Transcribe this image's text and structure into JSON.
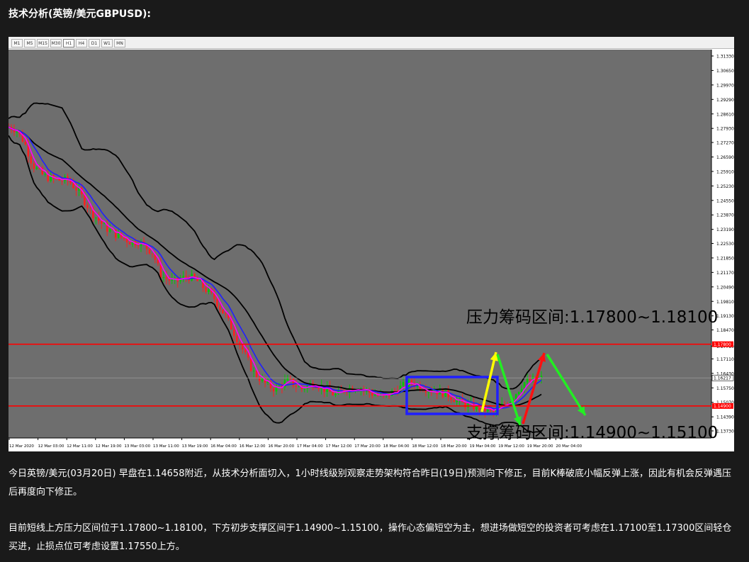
{
  "page": {
    "heading": "技术分析(英镑/美元GBPUSD):",
    "paragraphs": [
      "今日英镑/美元(03月20日) 早盘在1.14658附近，从技术分析面切入，1小时线级别观察走势架构符合昨日(19日)预测向下修正，目前K棒破底小幅反弹上涨，因此有机会反弹遇压后再度向下修正。",
      "目前短线上方压力区间位于1.17800~1.18100，下方初步支撑区间于1.14900~1.15100，操作心态偏短空为主，想进场做短空的投资者可考虑在1.17100至1.17300区间轻仓买进，止损点位可考虑设置1.17550上方。"
    ]
  },
  "chart": {
    "timeframes": [
      "M1",
      "M5",
      "M15",
      "M30",
      "H1",
      "H4",
      "D1",
      "W1",
      "MN"
    ],
    "active_timeframe": "H1",
    "resistance_label": "压力筹码区间:1.17800~1.18100",
    "support_label": "支撑筹码区间:1.14900~1.15100",
    "resistance_level": 1.178,
    "support_level": 1.149,
    "current_price": 1.16217,
    "current_price_label": "1.16217",
    "resistance_tag": "1.17800",
    "support_tag": "1.14900",
    "price_ticks": [
      "1.31330",
      "1.30650",
      "1.29970",
      "1.29290",
      "1.28610",
      "1.27930",
      "1.27270",
      "1.26590",
      "1.25910",
      "1.25230",
      "1.24550",
      "1.23870",
      "1.23190",
      "1.22530",
      "1.21850",
      "1.21170",
      "1.20490",
      "1.19810",
      "1.19130",
      "1.18470",
      "1.17710",
      "1.17110",
      "1.16430",
      "1.15750",
      "1.15070",
      "1.14390",
      "1.13730"
    ],
    "time_ticks": [
      "12 Mar 2020",
      "12 Mar 03:00",
      "12 Mar 11:00",
      "12 Mar 19:00",
      "13 Mar 03:00",
      "13 Mar 11:00",
      "13 Mar 19:00",
      "16 Mar 04:00",
      "16 Mar 12:00",
      "16 Mar 20:00",
      "17 Mar 04:00",
      "17 Mar 12:00",
      "17 Mar 20:00",
      "18 Mar 04:00",
      "18 Mar 12:00",
      "18 Mar 20:00",
      "19 Mar 04:00",
      "19 Mar 12:00",
      "19 Mar 20:00",
      "20 Mar 04:00"
    ],
    "colors": {
      "background": "#6e6e6e",
      "bollinger": "#000000",
      "ma_fast": "#ff00ff",
      "ma_slow": "#1f1fff",
      "bull": "#00cc00",
      "bear": "#ff1f1f",
      "level_line": "#ff0000",
      "box": "#1f1fff",
      "arrow_yellow": "#ffff00",
      "arrow_green": "#22ee22",
      "arrow_red": "#ff1010"
    }
  }
}
